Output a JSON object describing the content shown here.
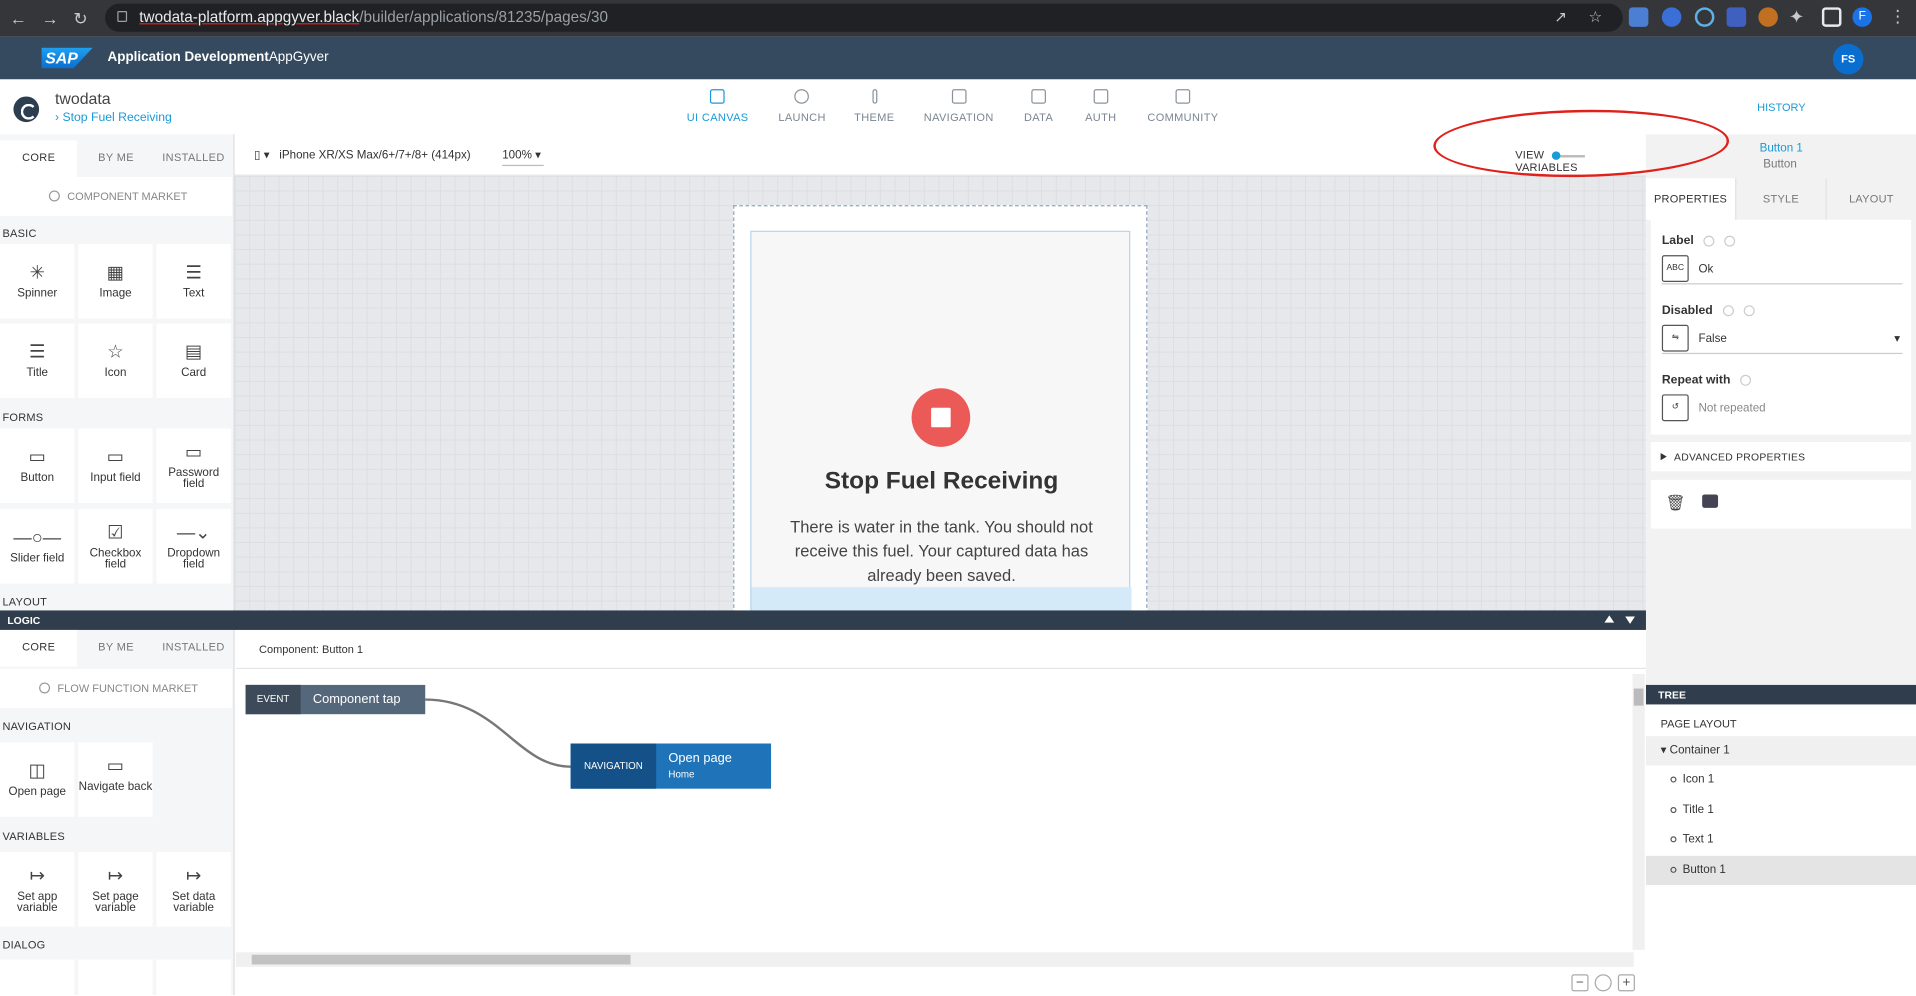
{
  "browser": {
    "url_host": "twodata-platform.appgyver.black",
    "url_path": "/builder/applications/81235/pages/30",
    "profile_initial": "F"
  },
  "sap": {
    "logo": "SAP",
    "title": "Application Development",
    "subtitle": "AppGyver",
    "user_initials": "FS"
  },
  "app": {
    "name": "twodata",
    "page": "Stop Fuel Receiving",
    "nav": [
      "UI CANVAS",
      "LAUNCH",
      "THEME",
      "NAVIGATION",
      "DATA",
      "AUTH",
      "COMMUNITY"
    ],
    "history": "HISTORY"
  },
  "left_panel": {
    "tabs": [
      "CORE",
      "BY ME",
      "INSTALLED"
    ],
    "market": "COMPONENT MARKET",
    "sections": [
      "BASIC",
      "FORMS",
      "LAYOUT"
    ],
    "basic": [
      "Spinner",
      "Image",
      "Text",
      "Title",
      "Icon",
      "Card"
    ],
    "forms": [
      "Button",
      "Input field",
      "Password field",
      "Slider field",
      "Checkbox field",
      "Dropdown field"
    ]
  },
  "toolbar": {
    "device": "iPhone XR/XS Max/6+/7+/8+ (414px)",
    "zoom": "100%",
    "view": "VIEW",
    "variables": "VARIABLES"
  },
  "phone": {
    "title": "Stop Fuel Receiving",
    "text": "There is water in the tank. You should not receive this fuel. Your captured data has already been saved."
  },
  "right_panel": {
    "selected_name": "Button 1",
    "selected_type": "Button",
    "tabs": [
      "PROPERTIES",
      "STYLE",
      "LAYOUT"
    ],
    "label_title": "Label",
    "label_value": "Ok",
    "disabled_title": "Disabled",
    "disabled_value": "False",
    "repeat_title": "Repeat with",
    "repeat_value": "Not repeated",
    "advanced": "ADVANCED PROPERTIES"
  },
  "logic": {
    "bar_title": "LOGIC",
    "tabs": [
      "CORE",
      "BY ME",
      "INSTALLED"
    ],
    "market": "FLOW FUNCTION MARKET",
    "sections": [
      "NAVIGATION",
      "VARIABLES",
      "DIALOG"
    ],
    "navigation": [
      "Open page",
      "Navigate back"
    ],
    "variables": [
      "Set app variable",
      "Set page variable",
      "Set data variable"
    ],
    "component": "Component: Button 1",
    "event_key": "EVENT",
    "event_text": "Component tap",
    "nav_key": "NAVIGATION",
    "nav_text": "Open page",
    "nav_sub": "Home"
  },
  "tree": {
    "title": "TREE",
    "root": "PAGE LAYOUT",
    "container": "Container 1",
    "items": [
      "Icon 1",
      "Title 1",
      "Text 1",
      "Button 1"
    ]
  },
  "colors": {
    "sap_bar": "#354a5f",
    "accent": "#1a9ad6",
    "stop_icon": "#ec5a58",
    "annotation": "#e0201a"
  }
}
